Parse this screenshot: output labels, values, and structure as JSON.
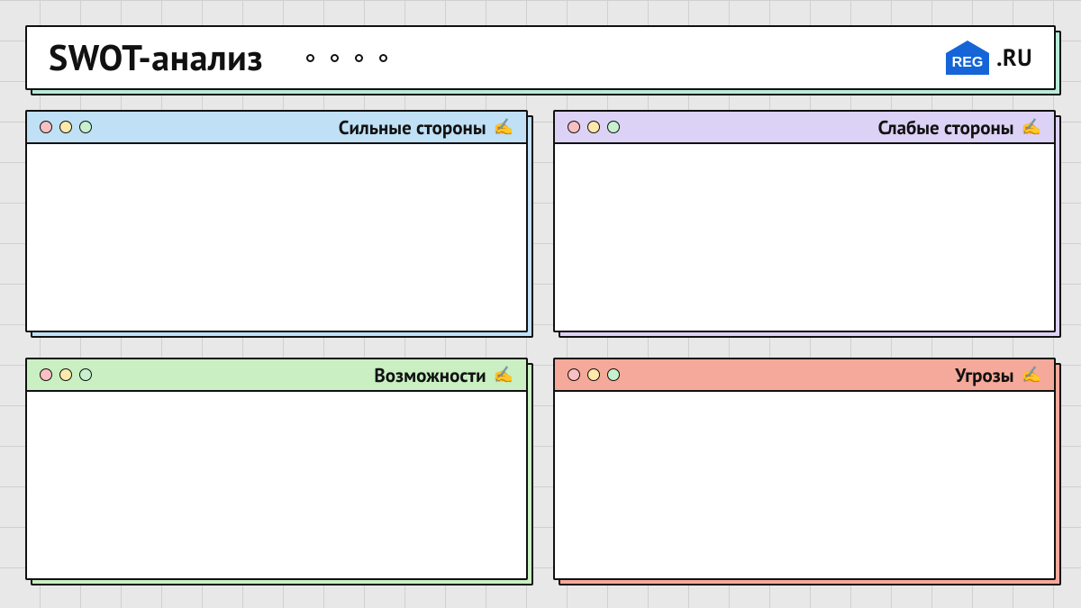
{
  "header": {
    "title": "SWOT-анализ",
    "logo_text_box": "REG",
    "logo_text_suffix": ".RU"
  },
  "panels": {
    "strengths": {
      "title": "Сильные стороны"
    },
    "weaknesses": {
      "title": "Слабые стороны"
    },
    "opportunities": {
      "title": "Возможности"
    },
    "threats": {
      "title": "Угрозы"
    }
  },
  "colors": {
    "strengths": "#bfe0f5",
    "weaknesses": "#dcd2f5",
    "opportunities": "#c9efc2",
    "threats": "#f5a99a",
    "header_shadow": "#b8ecd9",
    "logo_blue": "#1565d8"
  }
}
